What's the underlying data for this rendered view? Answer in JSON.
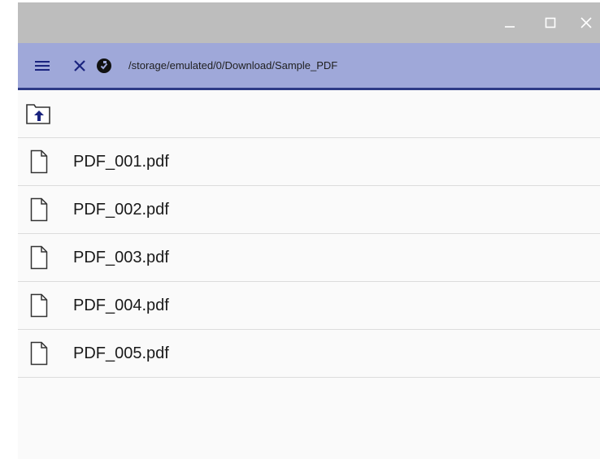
{
  "toolbar": {
    "path": "/storage/emulated/0/Download/Sample_PDF"
  },
  "icons": {
    "menu": "menu-icon",
    "close": "close-icon",
    "storage": "storage-icon",
    "folder_up": "folder-up-icon",
    "file": "file-icon",
    "window_minimize": "minimize-icon",
    "window_maximize": "maximize-icon",
    "window_close": "window-close-icon"
  },
  "files": [
    {
      "name": "PDF_001.pdf"
    },
    {
      "name": "PDF_002.pdf"
    },
    {
      "name": "PDF_003.pdf"
    },
    {
      "name": "PDF_004.pdf"
    },
    {
      "name": "PDF_005.pdf"
    }
  ],
  "colors": {
    "toolbar_bg": "#9fa8d9",
    "toolbar_border": "#2d3a86",
    "titlebar_bg": "#bdbdbd",
    "accent_icon": "#1a237e"
  }
}
